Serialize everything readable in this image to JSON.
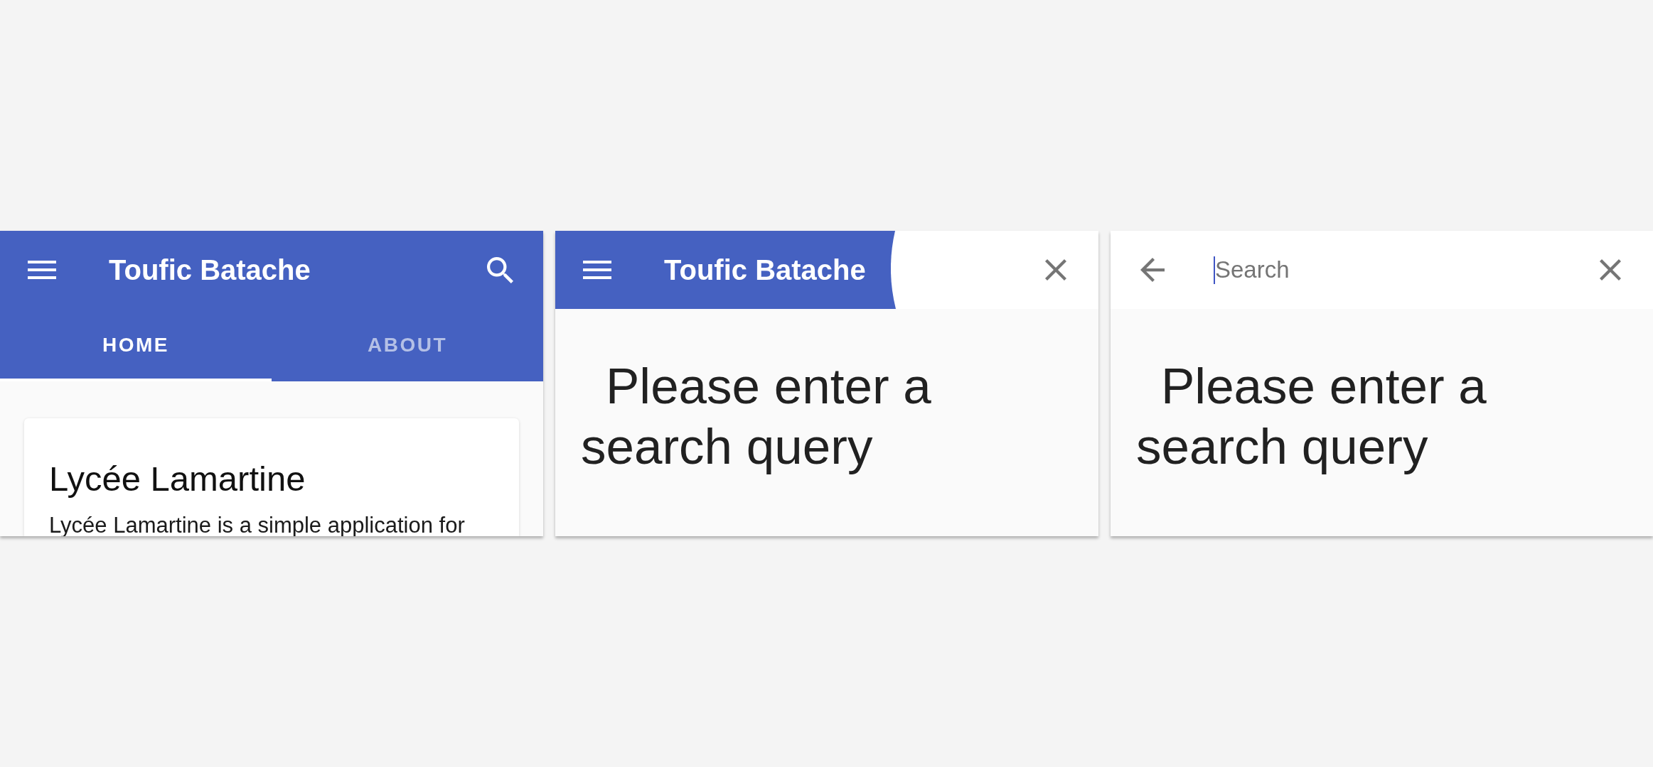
{
  "panels": [
    {
      "kind": "app_bar",
      "toolbar": {
        "title": "Toufic Batache"
      },
      "tabs": [
        {
          "label": "HOME",
          "selected": true
        },
        {
          "label": "ABOUT",
          "selected": false
        }
      ],
      "card": {
        "title": "Lycée Lamartine",
        "text": "Lycée Lamartine is a simple application for"
      }
    },
    {
      "kind": "search_opening",
      "toolbar": {
        "title": "Toufic Batache"
      },
      "message": "Please enter a search query"
    },
    {
      "kind": "search_bar",
      "search": {
        "placeholder": "Search",
        "focused": true
      },
      "message": "Please enter a search query"
    }
  ]
}
